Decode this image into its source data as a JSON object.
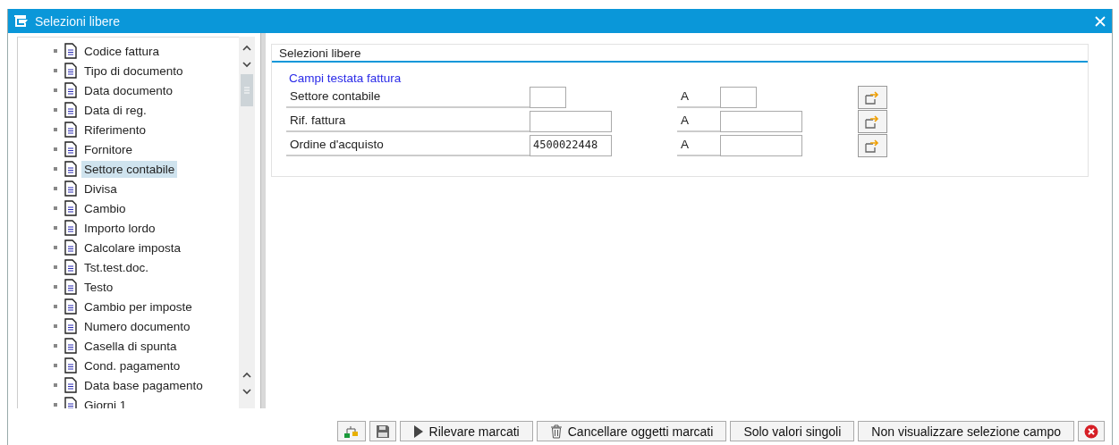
{
  "window": {
    "title": "Selezioni libere"
  },
  "tree": {
    "items": [
      {
        "label": "Codice fattura",
        "selected": false
      },
      {
        "label": "Tipo di documento",
        "selected": false
      },
      {
        "label": "Data documento",
        "selected": false
      },
      {
        "label": "Data di reg.",
        "selected": false
      },
      {
        "label": "Riferimento",
        "selected": false
      },
      {
        "label": "Fornitore",
        "selected": false
      },
      {
        "label": "Settore contabile",
        "selected": true
      },
      {
        "label": "Divisa",
        "selected": false
      },
      {
        "label": "Cambio",
        "selected": false
      },
      {
        "label": "Importo lordo",
        "selected": false
      },
      {
        "label": "Calcolare imposta",
        "selected": false
      },
      {
        "label": "Tst.test.doc.",
        "selected": false
      },
      {
        "label": "Testo",
        "selected": false
      },
      {
        "label": "Cambio per imposte",
        "selected": false
      },
      {
        "label": "Numero documento",
        "selected": false
      },
      {
        "label": "Casella di spunta",
        "selected": false
      },
      {
        "label": "Cond. pagamento",
        "selected": false
      },
      {
        "label": "Data base pagamento",
        "selected": false
      },
      {
        "label": "Giorni 1",
        "selected": false
      }
    ]
  },
  "selection": {
    "title": "Selezioni libere",
    "group": "Campi testata fattura",
    "rows": [
      {
        "label": "Settore contabile",
        "kind": "short",
        "from": "",
        "to_label": "A",
        "to": ""
      },
      {
        "label": "Rif. fattura",
        "kind": "long",
        "from": "",
        "to_label": "A",
        "to": ""
      },
      {
        "label": "Ordine d'acquisto",
        "kind": "long",
        "from": "4500022448",
        "to_label": "A",
        "to": ""
      }
    ]
  },
  "toolbar": {
    "buttons": [
      {
        "kind": "hierarchy"
      },
      {
        "kind": "save"
      },
      {
        "kind": "run",
        "label": "Rilevare marcati"
      },
      {
        "kind": "delete",
        "label": "Cancellare oggetti marcati"
      },
      {
        "kind": "text",
        "label": "Solo valori singoli"
      },
      {
        "kind": "text",
        "label": "Non visualizzare selezione campo"
      },
      {
        "kind": "cancel"
      }
    ]
  }
}
